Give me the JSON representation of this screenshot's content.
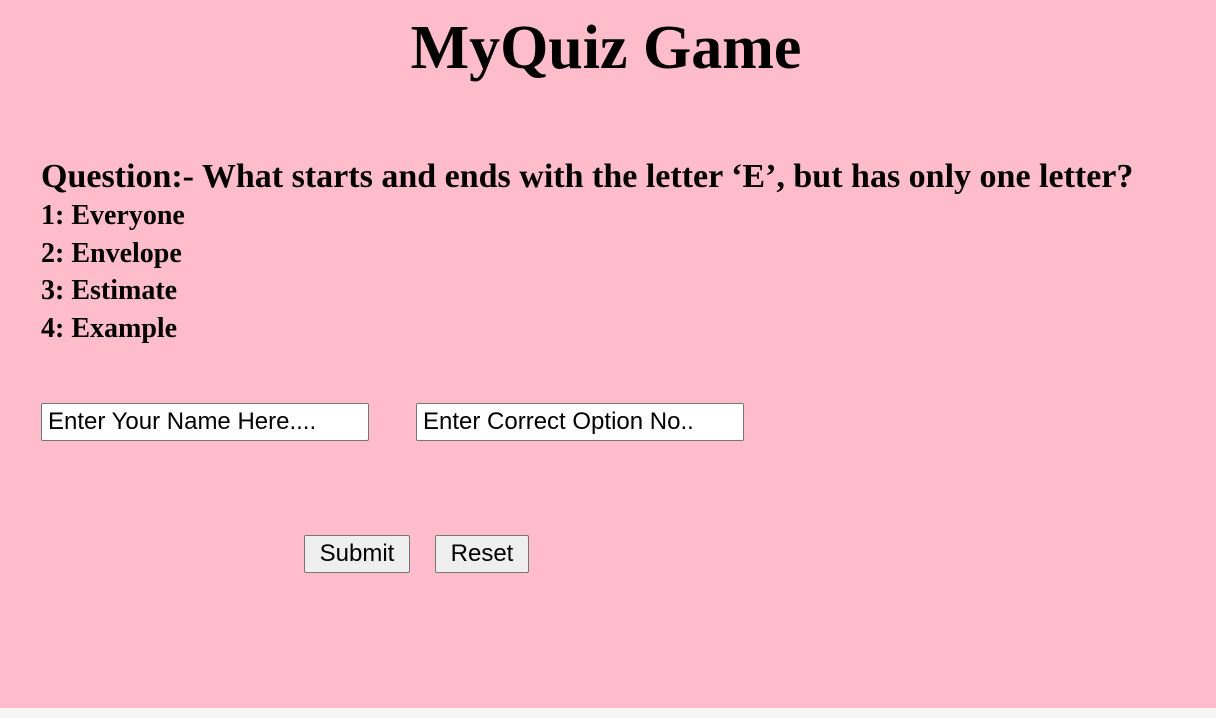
{
  "page": {
    "title": "MyQuiz Game",
    "background_color": "#ffbccb"
  },
  "quiz": {
    "question": "Question:- What starts and ends with the letter ‘E’, but has only one letter?",
    "options": [
      "1: Everyone",
      "2: Envelope",
      "3: Estimate",
      "4: Example"
    ]
  },
  "form": {
    "name_input": {
      "placeholder": "Enter Your Name Here....",
      "value": ""
    },
    "option_input": {
      "placeholder": "Enter Correct Option No..",
      "value": ""
    },
    "submit_label": "Submit",
    "reset_label": "Reset"
  }
}
